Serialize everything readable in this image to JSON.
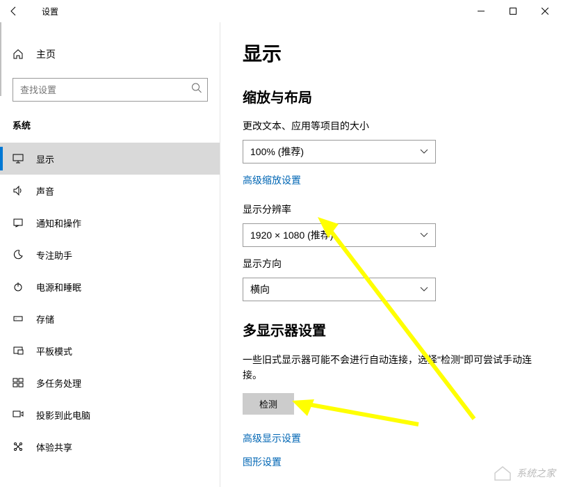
{
  "window": {
    "title": "设置"
  },
  "sidebar": {
    "home_label": "主页",
    "search_placeholder": "查找设置",
    "category": "系统",
    "items": [
      {
        "label": "显示",
        "icon": "monitor"
      },
      {
        "label": "声音",
        "icon": "sound"
      },
      {
        "label": "通知和操作",
        "icon": "notification"
      },
      {
        "label": "专注助手",
        "icon": "moon"
      },
      {
        "label": "电源和睡眠",
        "icon": "power"
      },
      {
        "label": "存储",
        "icon": "storage"
      },
      {
        "label": "平板模式",
        "icon": "tablet"
      },
      {
        "label": "多任务处理",
        "icon": "multitask"
      },
      {
        "label": "投影到此电脑",
        "icon": "project"
      },
      {
        "label": "体验共享",
        "icon": "share"
      }
    ]
  },
  "main": {
    "page_title": "显示",
    "section1": {
      "title": "缩放与布局",
      "scale_label": "更改文本、应用等项目的大小",
      "scale_value": "100% (推荐)",
      "advanced_scale_link": "高级缩放设置",
      "resolution_label": "显示分辨率",
      "resolution_value": "1920 × 1080 (推荐)",
      "orientation_label": "显示方向",
      "orientation_value": "横向"
    },
    "section2": {
      "title": "多显示器设置",
      "desc": "一些旧式显示器可能不会进行自动连接，选择\"检测\"即可尝试手动连接。",
      "detect_btn": "检测",
      "advanced_display_link": "高级显示设置",
      "graphics_link": "图形设置"
    }
  },
  "watermark": "系统之家"
}
